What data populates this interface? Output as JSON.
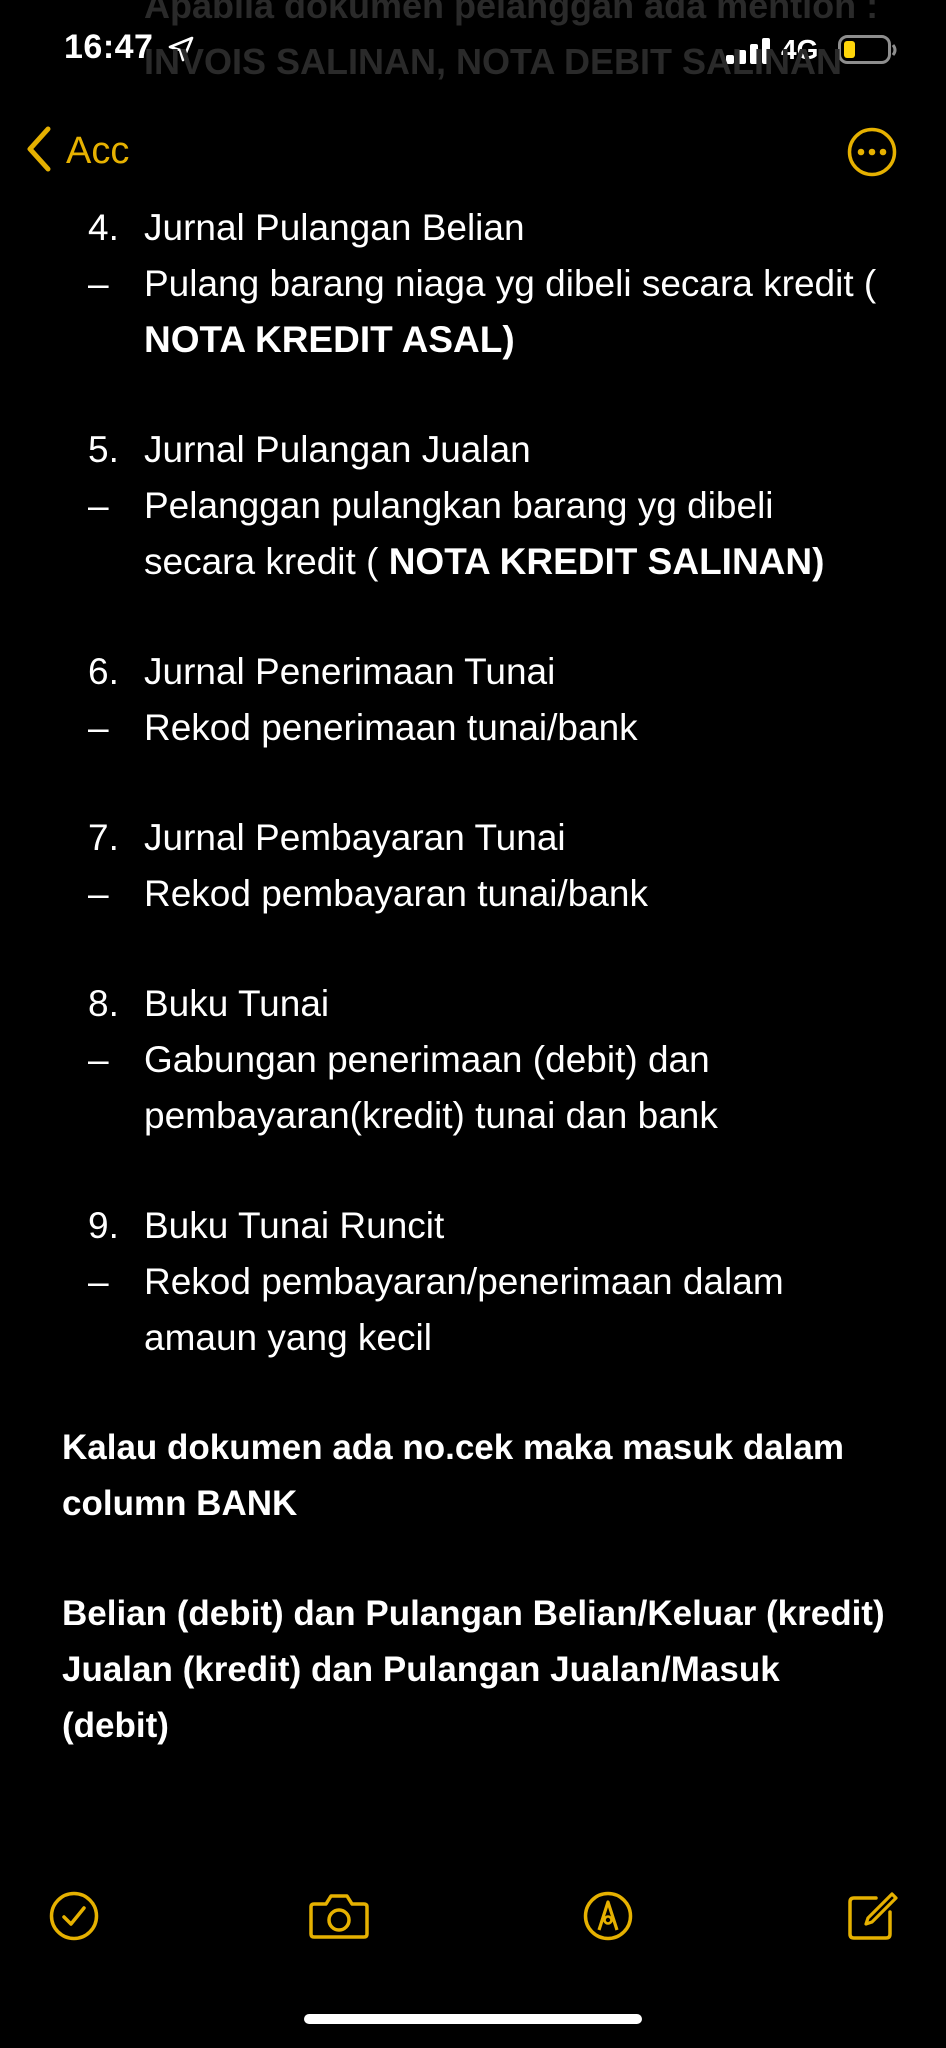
{
  "status": {
    "time": "16:47",
    "network": "4G"
  },
  "ghost_text": "Apabila dokumen pelanggan ada mention : INVOIS SALINAN, NOTA DEBIT SALINAN",
  "nav": {
    "back_label": "Acc"
  },
  "items": [
    {
      "num": "4.",
      "title": "Jurnal Pulangan Belian",
      "dash": "–",
      "desc": "Pulang barang niaga yg dibeli secara kredit ( ",
      "desc_bold": "NOTA KREDIT ASAL)"
    },
    {
      "num": "5.",
      "title": "Jurnal Pulangan Jualan",
      "dash": "–",
      "desc": "Pelanggan pulangkan barang yg dibeli secara kredit ( ",
      "desc_bold": "NOTA KREDIT SALINAN)"
    },
    {
      "num": "6.",
      "title": "Jurnal Penerimaan Tunai",
      "dash": "–",
      "desc": "Rekod penerimaan tunai/bank"
    },
    {
      "num": "7.",
      "title": "Jurnal Pembayaran Tunai",
      "dash": "–",
      "desc": "Rekod pembayaran tunai/bank"
    },
    {
      "num": "8.",
      "title": "Buku Tunai",
      "dash": "–",
      "desc": "Gabungan penerimaan (debit) dan pembayaran(kredit) tunai dan bank"
    },
    {
      "num": "9.",
      "title": "Buku Tunai Runcit",
      "dash": "–",
      "desc": "Rekod pembayaran/penerimaan dalam amaun yang kecil"
    }
  ],
  "notes": [
    "Kalau dokumen ada no.cek maka masuk dalam column BANK",
    "Belian (debit) dan Pulangan Belian/Keluar (kredit)",
    "Jualan (kredit) dan Pulangan Jualan/Masuk (debit)"
  ],
  "toolbar": {
    "checklist_icon": "checkmark-circle-icon",
    "camera_icon": "camera-icon",
    "markup_icon": "pen-tip-circle-icon",
    "compose_icon": "compose-icon"
  },
  "colors": {
    "accent": "#E6B100",
    "background": "#000000",
    "text": "#FFFFFF"
  }
}
